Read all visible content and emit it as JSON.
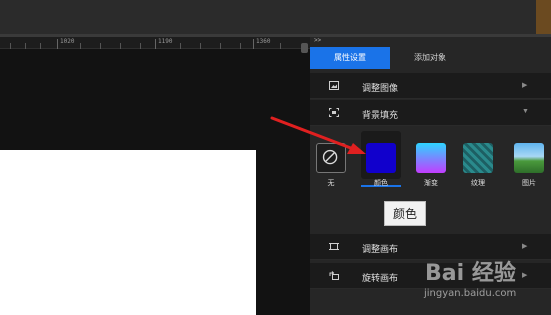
{
  "ruler": {
    "labels": [
      "1020",
      "1190",
      "1360"
    ]
  },
  "panel": {
    "collapse_arrows": ">>",
    "tabs": [
      {
        "label": "属性设置",
        "active": true
      },
      {
        "label": "添加对象",
        "active": false
      }
    ],
    "menu": {
      "adjust_image": {
        "label": "调整图像",
        "icon": "image-icon",
        "arrow": "▶"
      },
      "background_fill": {
        "label": "背景填充",
        "icon": "crop-icon",
        "arrow": "▼"
      },
      "adjust_canvas": {
        "label": "调整画布",
        "icon": "canvas-icon",
        "arrow": "▶"
      },
      "rotate_canvas": {
        "label": "旋转画布",
        "icon": "rotate-icon",
        "arrow": "▶"
      }
    },
    "fill_options": [
      {
        "label": "无",
        "type": "none",
        "icon": "no-fill-icon"
      },
      {
        "label": "颜色",
        "type": "color",
        "color": "#1100cc",
        "selected": true
      },
      {
        "label": "渐变",
        "type": "gradient",
        "colors": [
          "#2dd5ff",
          "#c23dff"
        ]
      },
      {
        "label": "纹理",
        "type": "texture",
        "color": "#2a8a8c"
      },
      {
        "label": "图片",
        "type": "image",
        "color": "#4aa3e0"
      }
    ]
  },
  "tooltip": {
    "text": "颜色"
  },
  "colors": {
    "accent": "#1a73e8",
    "arrow": "#e02020",
    "panel_bg": "#262626",
    "canvas_bg": "#121212"
  },
  "watermark": {
    "logo": "Bai 经验",
    "url": "jingyan.baidu.com"
  }
}
